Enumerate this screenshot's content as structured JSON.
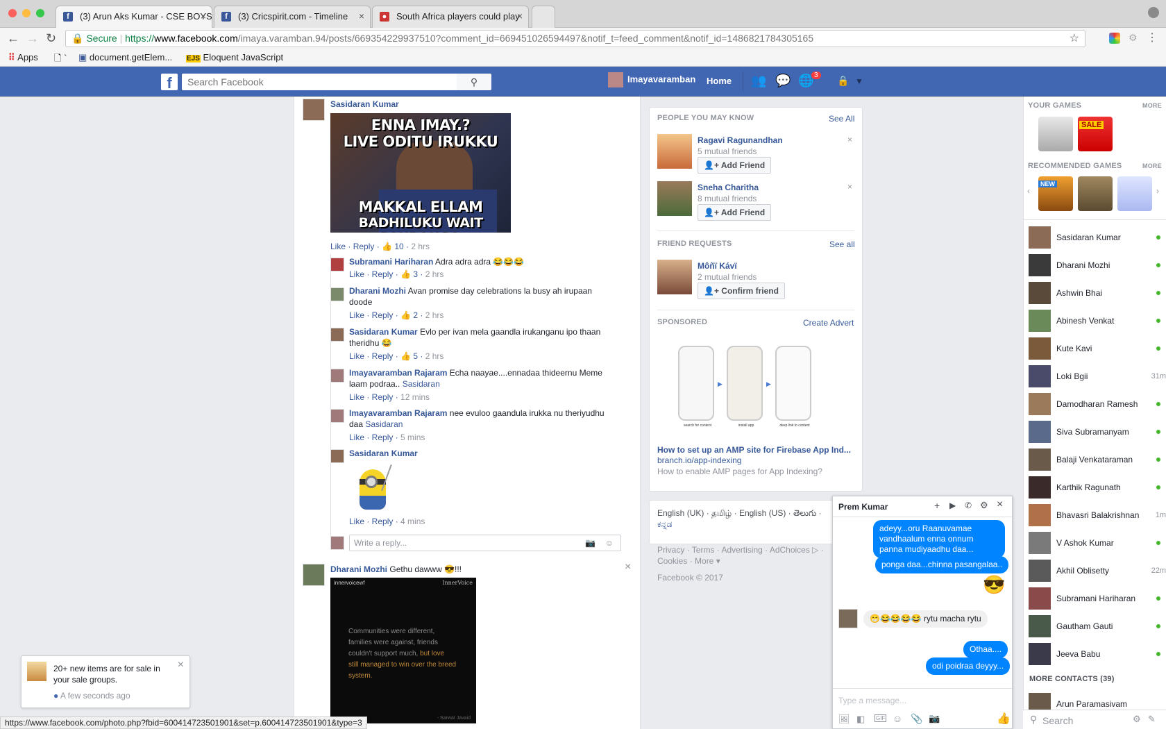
{
  "browser": {
    "tabs": [
      {
        "title": "(3) Arun Aks Kumar - CSE BOYS"
      },
      {
        "title": "(3) Cricspirit.com - Timeline"
      },
      {
        "title": "South Africa players could play"
      }
    ],
    "secure_label": "Secure",
    "url_prefix": "https://",
    "url_host": "www.facebook.com",
    "url_rest": "/imaya.varamban.94/posts/669354229937510?comment_id=669451026594497&notif_t=feed_comment&notif_id=1486821784305165",
    "bookmarks": [
      {
        "label": "Apps"
      },
      {
        "label": "`"
      },
      {
        "label": "document.getElem..."
      },
      {
        "label": "Eloquent JavaScript"
      }
    ],
    "status_url": "https://www.facebook.com/photo.php?fbid=600414723501901&set=p.600414723501901&type=3"
  },
  "fb_header": {
    "search_placeholder": "Search Facebook",
    "user_name": "Imayavaramban",
    "home_label": "Home",
    "notif_count": "3"
  },
  "feed": {
    "top_comment": {
      "author": "Sasidaran Kumar",
      "meme_top": "ENNA IMAY.?",
      "meme_top2": "LIVE ODITU IRUKKU",
      "meme_bottom": "MAKKAL ELLAM",
      "meme_bottom2": "BADHILUKU WAIT PANRANGA",
      "like": "Like",
      "reply": "Reply",
      "likes": "10",
      "time": "2 hrs"
    },
    "replies": [
      {
        "author": "Subramani Hariharan",
        "text": "Adra adra adra 😂😂😂",
        "likes": "3",
        "time": "2 hrs"
      },
      {
        "author": "Dharani Mozhi",
        "text": "Avan promise day celebrations la busy ah irupaan",
        "text2": "doode",
        "likes": "2",
        "time": "2 hrs"
      },
      {
        "author": "Sasidaran Kumar",
        "text": "Evlo per ivan mela gaandla irukanganu ipo thaan",
        "text2": "theridhu 😂",
        "likes": "5",
        "time": "2 hrs"
      },
      {
        "author": "Imayavaramban Rajaram",
        "text": "Echa naayae....ennadaa thideernu Meme",
        "text2": "laam podraa..",
        "tag": "Sasidaran",
        "time": "12 mins"
      },
      {
        "author": "Imayavaramban Rajaram",
        "text": "nee evuloo gaandula irukka nu theriyudhu",
        "text2": "daa",
        "tag": "Sasidaran",
        "time": "5 mins"
      },
      {
        "author": "Sasidaran Kumar",
        "time": "4 mins"
      }
    ],
    "reply_placeholder": "Write a reply...",
    "next_comment": {
      "author": "Dharani Mozhi",
      "text": "Gethu dawww 😎!!!",
      "image_brand": "innervoicewf",
      "image_brand2": "InnerVoice",
      "quote1": "Communities were different,",
      "quote2": "families were against, friends",
      "quote3": "couldn't support much,",
      "quote3b": "but love",
      "quote4": "still managed to win over the breed",
      "quote5": "system.",
      "signature": "- Sarwat Javaid"
    }
  },
  "right": {
    "pymk_header": "PEOPLE YOU MAY KNOW",
    "see_all": "See All",
    "pymk": [
      {
        "name": "Ragavi Ragunandhan",
        "mutual": "5 mutual friends",
        "button": "Add Friend"
      },
      {
        "name": "Sneha Charitha",
        "mutual": "8 mutual friends",
        "button": "Add Friend"
      }
    ],
    "fr_header": "FRIEND REQUESTS",
    "fr_see_all": "See all",
    "fr": {
      "name": "Môñï Kávï",
      "mutual": "2 mutual friends",
      "button": "Confirm friend"
    },
    "sponsored_header": "SPONSORED",
    "create_advert": "Create Advert",
    "ad_step1": "search for content",
    "ad_step2": "install app",
    "ad_step3": "deep link to content",
    "ad_title": "How to set up an AMP site for Firebase App Ind...",
    "ad_domain": "branch.io/app-indexing",
    "ad_desc": "How to enable AMP pages for App Indexing?",
    "languages": "English (UK) · தமிழ் · English (US) · తెలుగు ·",
    "languages2": "ಕನ್ನಡ",
    "footer_links": "Privacy · Terms · Advertising · AdChoices ▷ ·",
    "footer_links2": "Cookies · More ▾",
    "copyright": "Facebook © 2017"
  },
  "games": {
    "your_games": "YOUR GAMES",
    "more": "MORE",
    "sale": "SALE",
    "recommended": "RECOMMENDED GAMES",
    "new": "NEW"
  },
  "chat": {
    "contacts": [
      {
        "name": "Sasidaran Kumar",
        "status": "online",
        "ago": ""
      },
      {
        "name": "Dharani Mozhi",
        "status": "online",
        "ago": ""
      },
      {
        "name": "Ashwin Bhai",
        "status": "online",
        "ago": ""
      },
      {
        "name": "Abinesh Venkat",
        "status": "online",
        "ago": ""
      },
      {
        "name": "Kute Kavi",
        "status": "online",
        "ago": ""
      },
      {
        "name": "Loki Bgii",
        "status": "away",
        "ago": "31m"
      },
      {
        "name": "Damodharan Ramesh",
        "status": "online",
        "ago": ""
      },
      {
        "name": "Siva Subramanyam",
        "status": "online",
        "ago": ""
      },
      {
        "name": "Balaji Venkataraman",
        "status": "online",
        "ago": ""
      },
      {
        "name": "Karthik Ragunath",
        "status": "online",
        "ago": ""
      },
      {
        "name": "Bhavasri Balakrishnan",
        "status": "away",
        "ago": "1m"
      },
      {
        "name": "V Ashok Kumar",
        "status": "online",
        "ago": ""
      },
      {
        "name": "Akhil Oblisetty",
        "status": "away",
        "ago": "22m"
      },
      {
        "name": "Subramani Hariharan",
        "status": "online",
        "ago": ""
      },
      {
        "name": "Gautham Gauti",
        "status": "online",
        "ago": ""
      },
      {
        "name": "Jeeva Babu",
        "status": "online",
        "ago": ""
      }
    ],
    "more_contacts": "MORE CONTACTS (39)",
    "more_contact_first": "Arun Paramasivam",
    "search_placeholder": "Search"
  },
  "messenger": {
    "contact": "Prem Kumar",
    "messages": [
      {
        "text": "adeyy...oru Raanuvamae vandhaalum enna onnum panna mudiyaadhu daa..."
      },
      {
        "text": "ponga daa...chinna pasangalaa.."
      },
      {
        "text": "😎"
      },
      {
        "text": "😁😂😂😂😂 rytu macha rytu"
      },
      {
        "text": "Othaa...."
      },
      {
        "text": "odi poidraa deyyy..."
      }
    ],
    "input_placeholder": "Type a message..."
  },
  "toast": {
    "text": "20+ new items are for sale in your sale groups.",
    "time": "A few seconds ago"
  }
}
